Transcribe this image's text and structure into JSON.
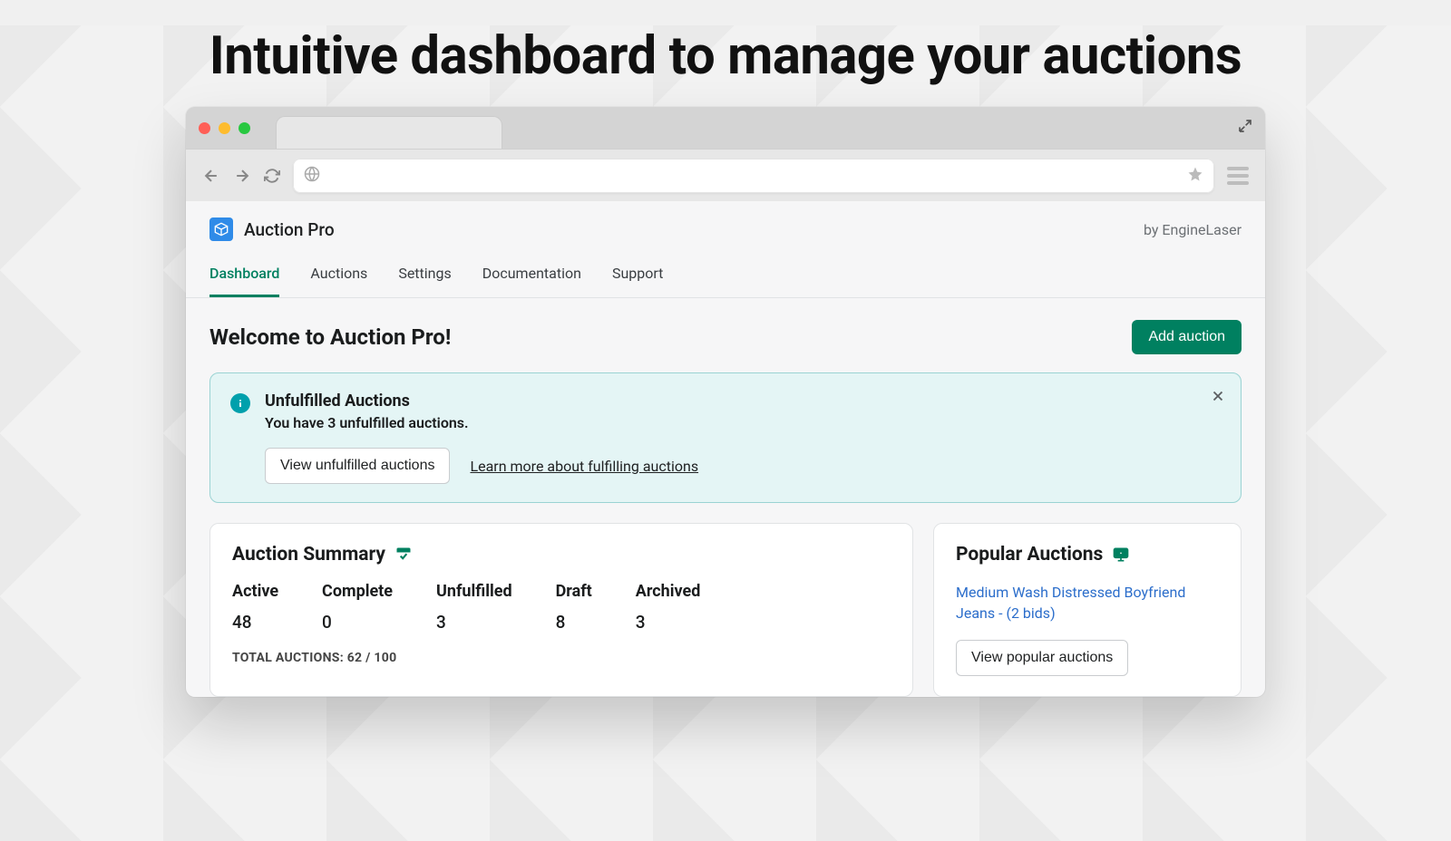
{
  "headline": "Intuitive dashboard to manage your auctions",
  "app": {
    "title": "Auction Pro",
    "byline": "by EngineLaser"
  },
  "tabs": [
    {
      "label": "Dashboard",
      "active": true
    },
    {
      "label": "Auctions",
      "active": false
    },
    {
      "label": "Settings",
      "active": false
    },
    {
      "label": "Documentation",
      "active": false
    },
    {
      "label": "Support",
      "active": false
    }
  ],
  "welcome": {
    "title": "Welcome to Auction Pro!",
    "add_button": "Add auction"
  },
  "banner": {
    "title": "Unfulfilled Auctions",
    "subtitle": "You have 3 unfulfilled auctions.",
    "view_button": "View unfulfilled auctions",
    "learn_link": "Learn more about fulfilling auctions"
  },
  "summary": {
    "title": "Auction Summary",
    "stats": [
      {
        "label": "Active",
        "value": "48"
      },
      {
        "label": "Complete",
        "value": "0"
      },
      {
        "label": "Unfulfilled",
        "value": "3"
      },
      {
        "label": "Draft",
        "value": "8"
      },
      {
        "label": "Archived",
        "value": "3"
      }
    ],
    "total": "TOTAL AUCTIONS: 62 / 100"
  },
  "popular": {
    "title": "Popular Auctions",
    "item": "Medium Wash Distressed Boyfriend Jeans - (2 bids)",
    "view_button": "View popular auctions"
  },
  "urlbar_placeholder": ""
}
